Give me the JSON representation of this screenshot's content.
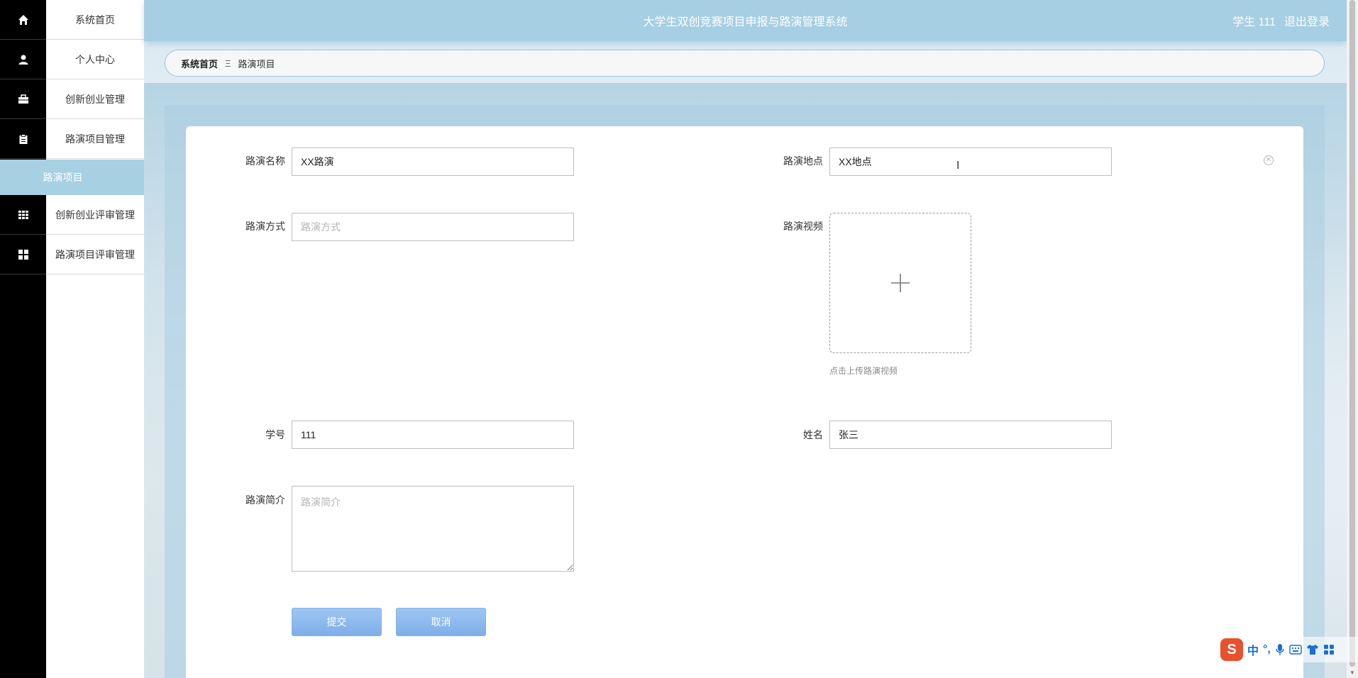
{
  "app": {
    "title": "大学生双创竞赛项目申报与路演管理系统",
    "user_label": "学生 111",
    "logout_label": "退出登录"
  },
  "sidebar": {
    "items": [
      {
        "label": "系统首页",
        "icon": "home-icon"
      },
      {
        "label": "个人中心",
        "icon": "user-icon"
      },
      {
        "label": "创新创业管理",
        "icon": "briefcase-icon"
      },
      {
        "label": "路演项目管理",
        "icon": "clipboard-icon"
      },
      {
        "label": "创新创业评审管理",
        "icon": "grid-icon"
      },
      {
        "label": "路演项目评审管理",
        "icon": "apps-icon"
      }
    ],
    "active_sub": "路演项目"
  },
  "breadcrumb": {
    "home": "系统首页",
    "separator": "Ξ",
    "current": "路演项目"
  },
  "form": {
    "name": {
      "label": "路演名称",
      "value": "XX路演",
      "placeholder": "路演名称"
    },
    "location": {
      "label": "路演地点",
      "value": "XX地点",
      "placeholder": "路演地点"
    },
    "method": {
      "label": "路演方式",
      "value": "",
      "placeholder": "路演方式"
    },
    "video": {
      "label": "路演视频",
      "tip": "点击上传路演视频"
    },
    "student_id": {
      "label": "学号",
      "value": "111",
      "placeholder": "学号"
    },
    "student_name": {
      "label": "姓名",
      "value": "张三",
      "placeholder": "姓名"
    },
    "intro": {
      "label": "路演简介",
      "value": "",
      "placeholder": "路演简介"
    },
    "submit_label": "提交",
    "cancel_label": "取消"
  },
  "ime": {
    "logo": "S",
    "mode": "中",
    "punct": "°,"
  },
  "colors": {
    "header_bg": "#a6cfe3",
    "sidebar_active": "#a7d0e3",
    "button": "#8fbaee"
  }
}
